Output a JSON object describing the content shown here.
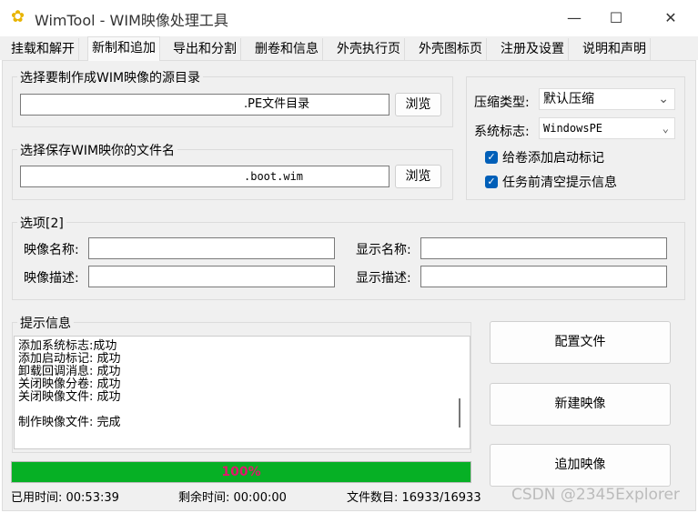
{
  "window": {
    "title": "WimTool - WIM映像处理工具",
    "minimize": "—",
    "maximize": "☐",
    "close": "✕"
  },
  "tabs": [
    "挂载和解开",
    "新制和追加",
    "导出和分割",
    "删卷和信息",
    "外壳执行页",
    "外壳图标页",
    "注册及设置",
    "说明和声明"
  ],
  "source": {
    "label": "选择要制作成WIM映像的源目录",
    "value": ".PE文件目录",
    "browse": "浏览"
  },
  "target": {
    "label": "选择保存WIM映你的文件名",
    "value": ".boot.wim",
    "browse": "浏览"
  },
  "options_right": {
    "compress_label": "压缩类型:",
    "compress_value": "默认压缩",
    "flag_label": "系统标志:",
    "flag_value": "WindowsPE",
    "chk1": "给卷添加启动标记",
    "chk2": "任务前清空提示信息"
  },
  "options": {
    "label": "选项[2]",
    "image_name": "映像名称:",
    "display_name": "显示名称:",
    "image_desc": "映像描述:",
    "display_desc": "显示描述:"
  },
  "log": {
    "label": "提示信息",
    "lines": [
      "添加系统标志:成功",
      "添加启动标记: 成功",
      "卸载回调消息: 成功",
      "关闭映像分卷: 成功",
      "关闭映像文件: 成功",
      "",
      "制作映像文件: 完成"
    ]
  },
  "buttons": {
    "config": "配置文件",
    "create": "新建映像",
    "append": "追加映像"
  },
  "progress": {
    "percent": 100,
    "label": "100%",
    "color": "#06b025"
  },
  "status": {
    "elapsed": "已用时间: 00:53:39",
    "remaining": "剩余时间: 00:00:00",
    "files": "文件数目: 16933/16933"
  },
  "watermark": "CSDN @2345Explorer"
}
